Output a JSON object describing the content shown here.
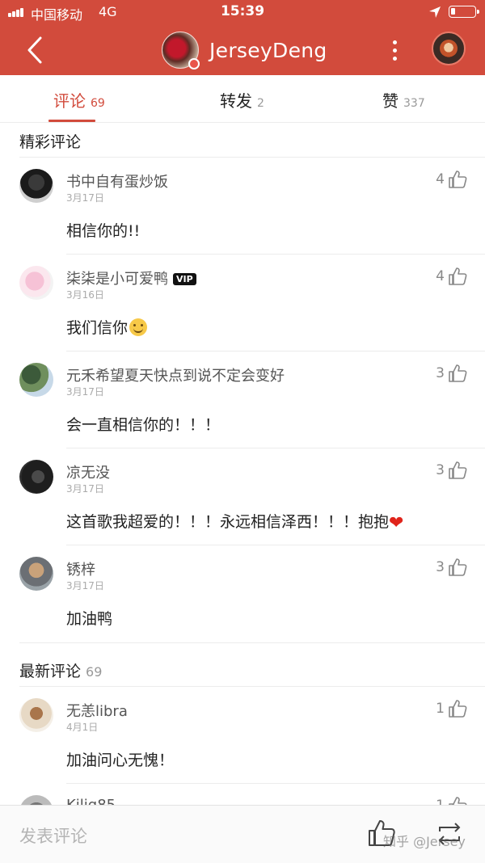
{
  "status_bar": {
    "carrier": "中国移动",
    "network": "4G",
    "time": "15:39"
  },
  "header": {
    "title": "JerseyDeng",
    "back_icon": "chevron-left-icon",
    "more_icon": "more-vertical-icon"
  },
  "tabs": [
    {
      "label": "评论",
      "count": "69",
      "active": true
    },
    {
      "label": "转发",
      "count": "2",
      "active": false
    },
    {
      "label": "赞",
      "count": "337",
      "active": false
    }
  ],
  "hot_section": {
    "title": "精彩评论"
  },
  "hot_comments": [
    {
      "user": "书中自有蛋炒饭",
      "date": "3月17日",
      "likes": "4",
      "text": "相信你的!!"
    },
    {
      "user": "柒柒是小可爱鸭",
      "badge": "VIP",
      "date": "3月16日",
      "likes": "4",
      "text": "我们信你"
    },
    {
      "user": "元禾希望夏天快点到说不定会变好",
      "date": "3月17日",
      "likes": "3",
      "text": "会一直相信你的！！！"
    },
    {
      "user": "凉无没",
      "date": "3月17日",
      "likes": "3",
      "text": "这首歌我超爱的！！！永远相信泽西！！！抱抱"
    },
    {
      "user": "锈梓",
      "date": "3月17日",
      "likes": "3",
      "text": "加油鸭"
    }
  ],
  "latest_section": {
    "title": "最新评论",
    "count": "69"
  },
  "latest_comments": [
    {
      "user": "无恙libra",
      "date": "4月1日",
      "likes": "1",
      "text": "加油问心无愧！"
    },
    {
      "user": "Kilig85",
      "likes": "1"
    }
  ],
  "bottom_bar": {
    "placeholder": "发表评论",
    "like_icon": "thumbs-up-icon",
    "share_icon": "repost-icon"
  },
  "watermark": "知乎 @Jersey",
  "colors": {
    "brand": "#d24b3c",
    "heart": "#e0241b"
  }
}
